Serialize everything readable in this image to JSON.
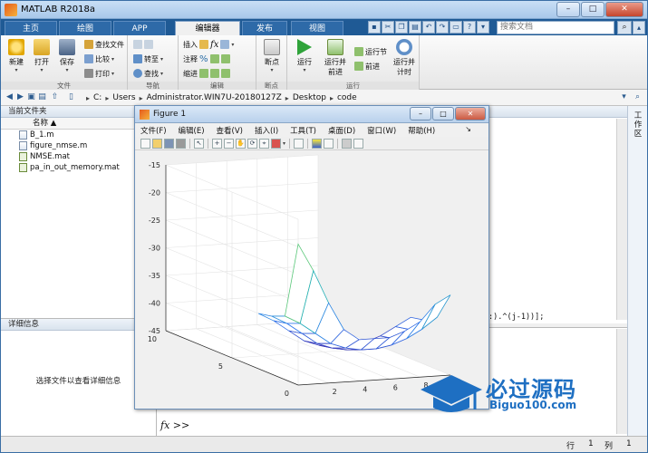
{
  "window": {
    "title": "MATLAB R2018a"
  },
  "tabs": [
    {
      "label": "主页"
    },
    {
      "label": "绘图"
    },
    {
      "label": "APP"
    },
    {
      "label": "编辑器"
    },
    {
      "label": "发布"
    },
    {
      "label": "视图"
    }
  ],
  "search": {
    "placeholder": "搜索文档"
  },
  "ribbon": {
    "file": {
      "group_label": "文件",
      "new": "新建",
      "open": "打开",
      "save": "保存",
      "find_files": "查找文件",
      "compare": "比较",
      "print": "打印"
    },
    "nav": {
      "group_label": "导航",
      "goto": "转至",
      "find": "查找"
    },
    "edit": {
      "group_label": "编辑",
      "insert": "插入",
      "comment": "注释",
      "indent": "缩进"
    },
    "breakpoints": {
      "group_label": "断点",
      "breakpoints": "断点"
    },
    "run": {
      "group_label": "运行",
      "run": "运行",
      "run_advance": "运行并前进",
      "run_section": "运行节",
      "advance": "前进",
      "run_time": "运行并计时"
    }
  },
  "address": {
    "crumbs": [
      "C:",
      "Users",
      "Administrator.WIN7U-20180127Z",
      "Desktop",
      "code"
    ]
  },
  "current_folder": {
    "title": "当前文件夹",
    "column_name": "名称 ▲",
    "files": [
      {
        "name": "B_1.m",
        "type": "m"
      },
      {
        "name": "figure_nmse.m",
        "type": "m"
      },
      {
        "name": "NMSE.mat",
        "type": "mat"
      },
      {
        "name": "pa_in_out_memory.mat",
        "type": "mat"
      }
    ]
  },
  "details": {
    "title": "详细信息",
    "message": "选择文件以查看详细信息"
  },
  "editor": {
    "code_fragment": ":).^(j-1))];"
  },
  "command": {
    "prompt": "fx >>"
  },
  "workspace_side": {
    "label": "工作区"
  },
  "status": {
    "row_label": "行",
    "row_value": "1",
    "col_label": "列",
    "col_value": "1"
  },
  "figure": {
    "title": "Figure 1",
    "menu": [
      "文件(F)",
      "编辑(E)",
      "查看(V)",
      "插入(I)",
      "工具(T)",
      "桌面(D)",
      "窗口(W)",
      "帮助(H)"
    ]
  },
  "chart_data": {
    "type": "surface",
    "x": [
      0,
      1,
      2,
      3,
      4,
      5,
      6,
      7,
      8,
      9,
      10
    ],
    "y": [
      0,
      1,
      2,
      3,
      4,
      5,
      6,
      7,
      8,
      9,
      10
    ],
    "xticks": [
      2,
      4,
      6,
      8,
      10
    ],
    "yticks": [
      0,
      5,
      10
    ],
    "zticks": [
      -45,
      -40,
      -35,
      -30,
      -25,
      -20,
      -15
    ],
    "xlim": [
      0,
      10
    ],
    "ylim": [
      0,
      10
    ],
    "zlim": [
      -45,
      -15
    ],
    "rows_y": [
      0,
      1,
      2,
      3
    ],
    "z": [
      [
        -19.5,
        -24.5,
        -30.5,
        -35.5,
        -37.5,
        -37.5,
        -37.5,
        -36.5,
        -35.0,
        -32.0,
        -30.5
      ],
      [
        -33.5,
        -35.0,
        -37.0,
        -39.0,
        -40.0,
        -40.5,
        -40.5,
        -40.0,
        -39.0,
        -37.5,
        -35.5
      ],
      [
        -34.5,
        -36.0,
        -38.0,
        -40.0,
        -41.0,
        -41.5,
        -41.5,
        -41.0,
        -40.0,
        -38.5,
        -37.0
      ],
      [
        -35.0,
        -36.5,
        -38.5,
        -40.5,
        -41.5,
        -42.0,
        -42.0,
        -41.5,
        -40.5,
        -39.0,
        -37.5
      ]
    ],
    "grid": true,
    "colormap": "parula"
  },
  "watermark": {
    "cn": "必过源码",
    "en": "Biguo100.com"
  },
  "colors": {
    "tab_bar": "#1f5a95",
    "ribbon": "#f0f0f0",
    "accent": "#1e6fc2"
  }
}
